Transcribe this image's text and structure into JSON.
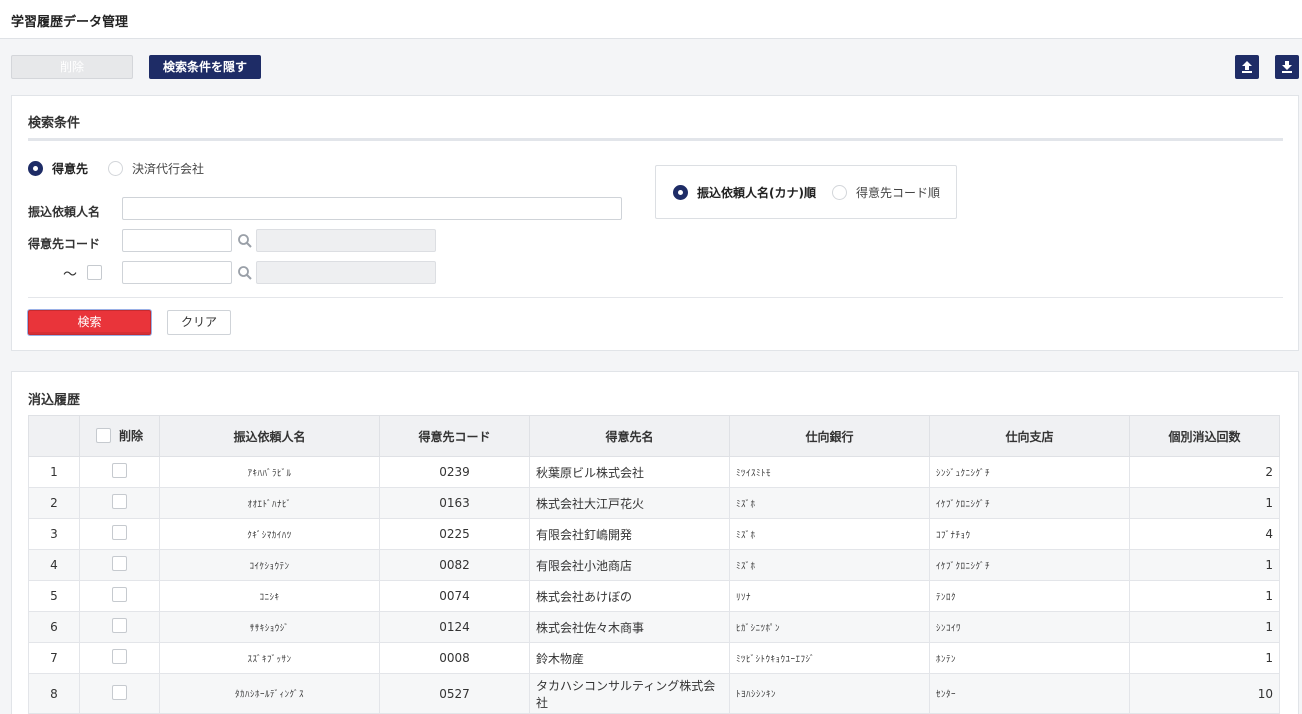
{
  "page": {
    "title": "学習履歴データ管理"
  },
  "toolbar": {
    "delete_label": "削除",
    "hide_conditions_label": "検索条件を隠す",
    "upload_icon": "upload-icon",
    "download_icon": "download-icon"
  },
  "search": {
    "title": "検索条件",
    "target_options": [
      {
        "label": "得意先",
        "selected": true
      },
      {
        "label": "決済代行会社",
        "selected": false
      }
    ],
    "payer_name_label": "振込依頼人名",
    "payer_name_value": "",
    "customer_code_label": "得意先コード",
    "customer_code_from": "",
    "customer_code_from_name": "",
    "range_tilde": "〜",
    "customer_code_to": "",
    "customer_code_to_name": "",
    "sort_options": [
      {
        "label": "振込依頼人名(カナ)順",
        "selected": true
      },
      {
        "label": "得意先コード順",
        "selected": false
      }
    ],
    "search_button": "検索",
    "clear_button": "クリア"
  },
  "history": {
    "title": "消込履歴",
    "columns": [
      "削除",
      "振込依頼人名",
      "得意先コード",
      "得意先名",
      "仕向銀行",
      "仕向支店",
      "個別消込回数"
    ],
    "rows": [
      {
        "no": "1",
        "payer_kana": "ｱｷﾊﾊﾞﾗﾋﾞﾙ",
        "code": "0239",
        "name": "秋葉原ビル株式会社",
        "bank": "ﾐﾂｲｽﾐﾄﾓ",
        "branch": "ｼﾝｼﾞｭｸﾆｼｸﾞﾁ",
        "count": "2"
      },
      {
        "no": "2",
        "payer_kana": "ｵｵｴﾄﾞﾊﾅﾋﾞ",
        "code": "0163",
        "name": "株式会社大江戸花火",
        "bank": "ﾐｽﾞﾎ",
        "branch": "ｲｹﾌﾞｸﾛﾆｼｸﾞﾁ",
        "count": "1"
      },
      {
        "no": "3",
        "payer_kana": "ｸｷﾞｼﾏｶｲﾊﾂ",
        "code": "0225",
        "name": "有限会社釘嶋開発",
        "bank": "ﾐｽﾞﾎ",
        "branch": "ｺﾌﾞﾅﾁｮｳ",
        "count": "4"
      },
      {
        "no": "4",
        "payer_kana": "ｺｲｹｼｮｳﾃﾝ",
        "code": "0082",
        "name": "有限会社小池商店",
        "bank": "ﾐｽﾞﾎ",
        "branch": "ｲｹﾌﾞｸﾛﾆｼｸﾞﾁ",
        "count": "1"
      },
      {
        "no": "5",
        "payer_kana": "ｺﾆｼｷ",
        "code": "0074",
        "name": "株式会社あけぼの",
        "bank": "ﾘｿﾅ",
        "branch": "ﾃﾝﾛｸ",
        "count": "1"
      },
      {
        "no": "6",
        "payer_kana": "ｻｻｷｼｮｳｼﾞ",
        "code": "0124",
        "name": "株式会社佐々木商事",
        "bank": "ﾋｶﾞｼﾆﾂﾎﾟﾝ",
        "branch": "ｼﾝｺｲﾜ",
        "count": "1"
      },
      {
        "no": "7",
        "payer_kana": "ｽｽﾞｷﾌﾞｯｻﾝ",
        "code": "0008",
        "name": "鈴木物産",
        "bank": "ﾐﾂﾋﾞｼﾄｳｷｮｳﾕｰｴﾌｼﾞ",
        "branch": "ﾎﾝﾃﾝ",
        "count": "1"
      },
      {
        "no": "8",
        "payer_kana": "ﾀｶﾊｼﾎｰﾙﾃﾞｨﾝｸﾞｽ",
        "code": "0527",
        "name": "タカハシコンサルティング株式会社",
        "bank": "ﾄﾖﾊｼｼﾝｷﾝ",
        "branch": "ｾﾝﾀｰ",
        "count": "10"
      }
    ]
  }
}
